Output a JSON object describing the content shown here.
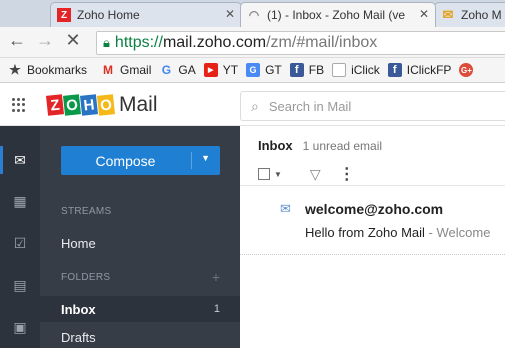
{
  "browser": {
    "tabs": [
      {
        "title": "Zoho Home",
        "favicon": "zoho-red"
      },
      {
        "title": "(1) - Inbox - Zoho Mail (ve",
        "favicon": "loading"
      },
      {
        "title": "Zoho M",
        "favicon": "zoho-envelope"
      }
    ],
    "url": {
      "scheme": "https://",
      "host": "mail.zoho.com",
      "path": "/zm/#mail/inbox"
    },
    "bookmarks": [
      {
        "label": "Bookmarks",
        "icon": "star-icon"
      },
      {
        "label": "Gmail",
        "icon": "gmail-icon"
      },
      {
        "label": "GA",
        "icon": "google-icon"
      },
      {
        "label": "YT",
        "icon": "youtube-icon"
      },
      {
        "label": "GT",
        "icon": "translate-icon"
      },
      {
        "label": "FB",
        "icon": "facebook-icon"
      },
      {
        "label": "iClick",
        "icon": "page-icon"
      },
      {
        "label": "IClickFP",
        "icon": "facebook-icon"
      },
      {
        "label": "",
        "icon": "google-plus-icon"
      }
    ]
  },
  "app": {
    "logo_text": "ZOHO",
    "product": "Mail",
    "search_placeholder": "Search in Mail"
  },
  "sidebar": {
    "compose_label": "Compose",
    "streams_heading": "STREAMS",
    "home_label": "Home",
    "folders_heading": "FOLDERS",
    "folders": [
      {
        "label": "Inbox",
        "count": "1",
        "selected": true
      },
      {
        "label": "Drafts",
        "count": "",
        "selected": false
      }
    ]
  },
  "mailbox": {
    "title": "Inbox",
    "unread_text": "1 unread email",
    "emails": [
      {
        "sender": "welcome@zoho.com",
        "subject": "Hello from Zoho Mail",
        "snippet": " - Welcome"
      }
    ]
  },
  "colors": {
    "accent": "#1f7fd2",
    "rail": "#2d333c",
    "nav": "#363d46",
    "secure": "#0b8043"
  }
}
